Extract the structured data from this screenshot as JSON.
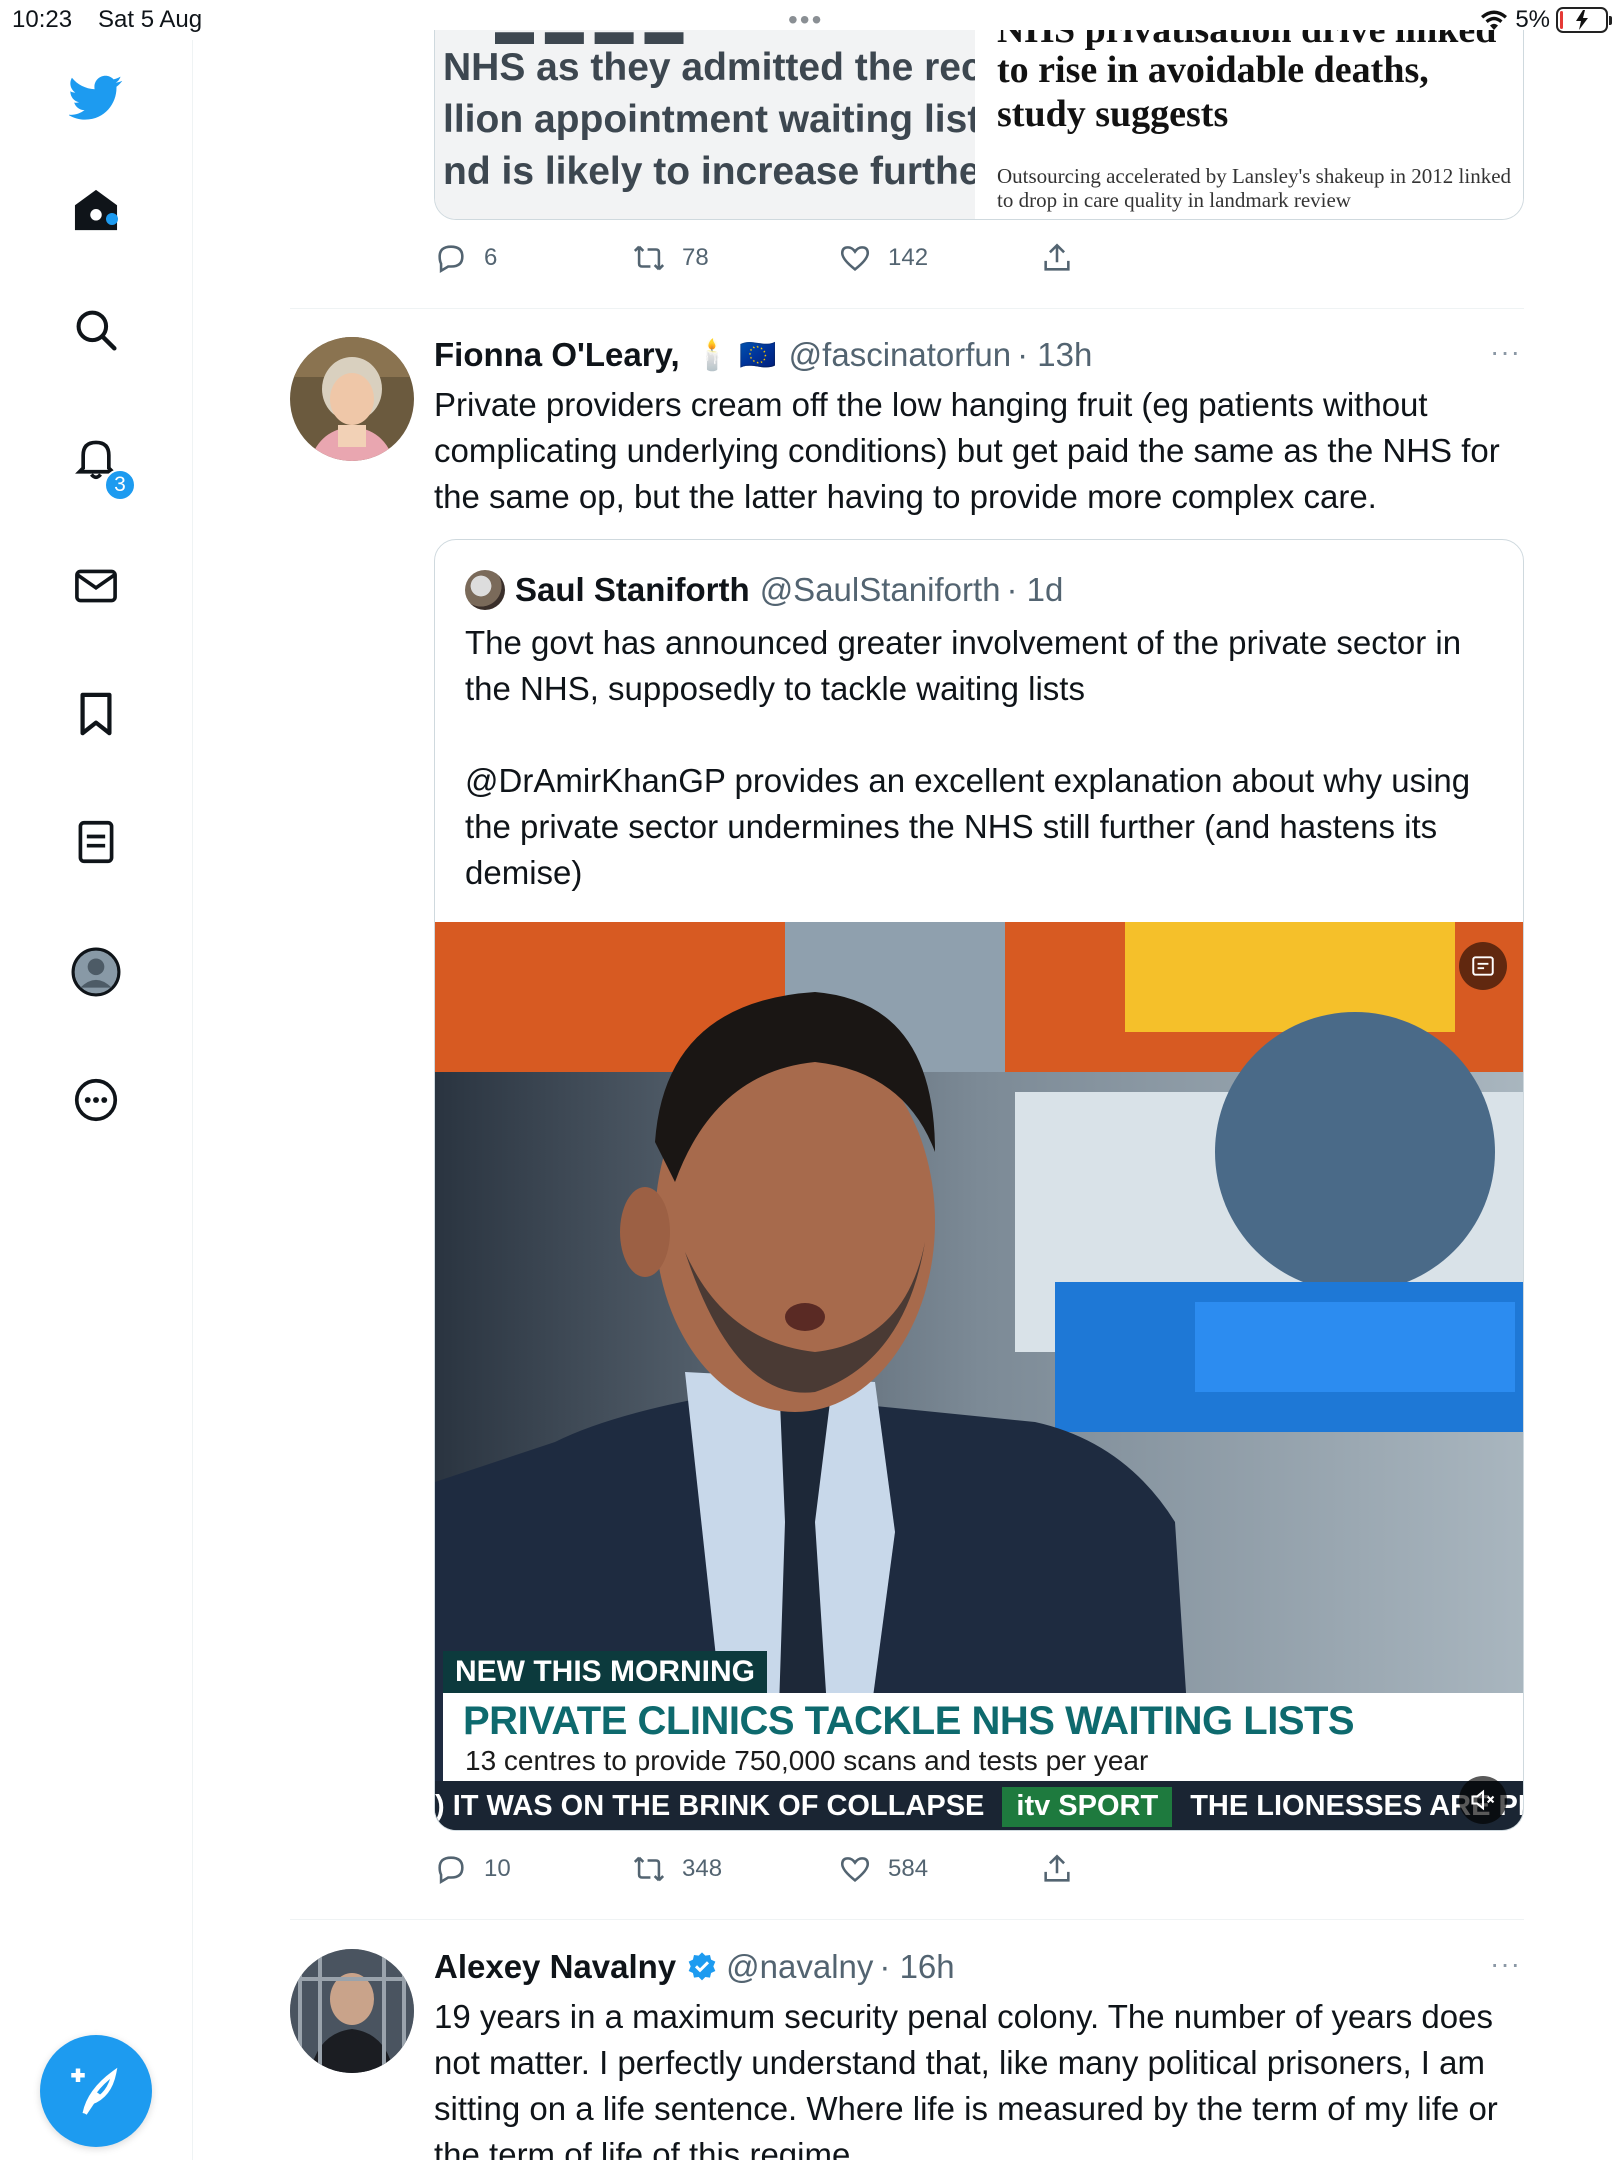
{
  "status_bar": {
    "time": "10:23",
    "date": "Sat 5 Aug",
    "battery": "5%",
    "battery_level_percent": 5
  },
  "sidebar": {
    "items": [
      {
        "name": "twitter-logo",
        "icon": "bird-icon"
      },
      {
        "name": "home",
        "icon": "home-icon"
      },
      {
        "name": "explore",
        "icon": "search-icon"
      },
      {
        "name": "notifications",
        "icon": "bell-icon",
        "badge": "3"
      },
      {
        "name": "messages",
        "icon": "envelope-icon"
      },
      {
        "name": "bookmarks",
        "icon": "bookmark-icon"
      },
      {
        "name": "lists",
        "icon": "list-icon"
      },
      {
        "name": "profile",
        "icon": "profile-icon"
      },
      {
        "name": "more",
        "icon": "more-circle-icon"
      }
    ],
    "notification_badge": "3",
    "accent": "#1d9bf0"
  },
  "top_card": {
    "image_lines": [
      "NHS as they admitted the rec",
      "llion appointment waiting list",
      "nd is likely to increase further"
    ],
    "headline_partial": "NHS privatisation drive linked",
    "headline": "to rise in avoidable deaths, study suggests",
    "subheadline": "Outsourcing accelerated by Lansley's shakeup in 2012 linked to drop in care quality in landmark review"
  },
  "top_actions": {
    "replies": "6",
    "retweets": "78",
    "likes": "142"
  },
  "tweet1": {
    "name": "Fionna O'Leary,",
    "emoji": "🕯️ 🇪🇺",
    "handle": "@fascinatorfun",
    "time": "· 13h",
    "more": "···",
    "text": "Private providers cream off the low hanging fruit (eg patients without complicating underlying conditions) but get paid the same as the NHS for the same op, but the latter having to provide more complex care.",
    "quote": {
      "name": "Saul Staniforth",
      "handle": "@SaulStaniforth",
      "time": "· 1d",
      "text1": "The govt has announced greater involvement of the private sector in the NHS, supposedly to tackle waiting lists",
      "text2": "@DrAmirKhanGP provides an excellent explanation about why using the private sector undermines the NHS still further (and hastens its demise)",
      "video": {
        "chyron_small": "NEW THIS MORNING",
        "chyron_main": "PRIVATE CLINICS TACKLE NHS WAITING LISTS",
        "chyron_sub": "13 centres to provide 750,000 scans and tests per year",
        "ticker_left": ") IT WAS ON THE BRINK OF COLLAPSE",
        "ticker_brand": "itv SPORT",
        "ticker_right": "THE LIONESSES ARE PREPA"
      }
    },
    "actions": {
      "replies": "10",
      "retweets": "348",
      "likes": "584"
    }
  },
  "tweet2": {
    "name": "Alexey Navalny",
    "handle": "@navalny",
    "time": "· 16h",
    "more": "···",
    "text": "19 years in a maximum security penal colony. The number of years does not matter. I perfectly understand that, like many political prisoners, I am sitting on a life sentence. Where life is measured by the term of my life or the term of life of this regime."
  }
}
